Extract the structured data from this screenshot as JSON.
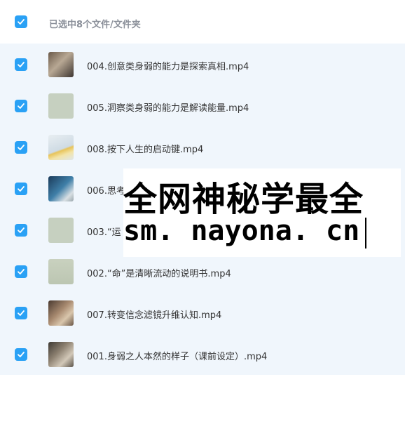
{
  "header": {
    "selection_text": "已选中8个文件/文件夹"
  },
  "files": [
    {
      "name": "004.创意类身弱的能力是探索真相.mp4",
      "thumb": "video-thumbnail"
    },
    {
      "name": "005.洞察类身弱的能力是解读能量.mp4",
      "thumb": "video-thumbnail"
    },
    {
      "name": "008.按下人生的启动键.mp4",
      "thumb": "video-thumbnail"
    },
    {
      "name": "006.思考",
      "thumb": "video-thumbnail"
    },
    {
      "name": "003.“运",
      "thumb": "video-thumbnail"
    },
    {
      "name": "002.“命”是清晰流动的说明书.mp4",
      "thumb": "video-thumbnail"
    },
    {
      "name": "007.转变信念滤镜升维认知.mp4",
      "thumb": "video-thumbnail"
    },
    {
      "name": "001.身弱之人本然的样子（课前设定）.mp4",
      "thumb": "video-thumbnail"
    }
  ],
  "watermark": {
    "line1": "全网神秘学最全",
    "line2": "sm. nayona. cn"
  },
  "colors": {
    "checkbox": "#2aa1f5",
    "list_bg": "#f0f6fc"
  }
}
